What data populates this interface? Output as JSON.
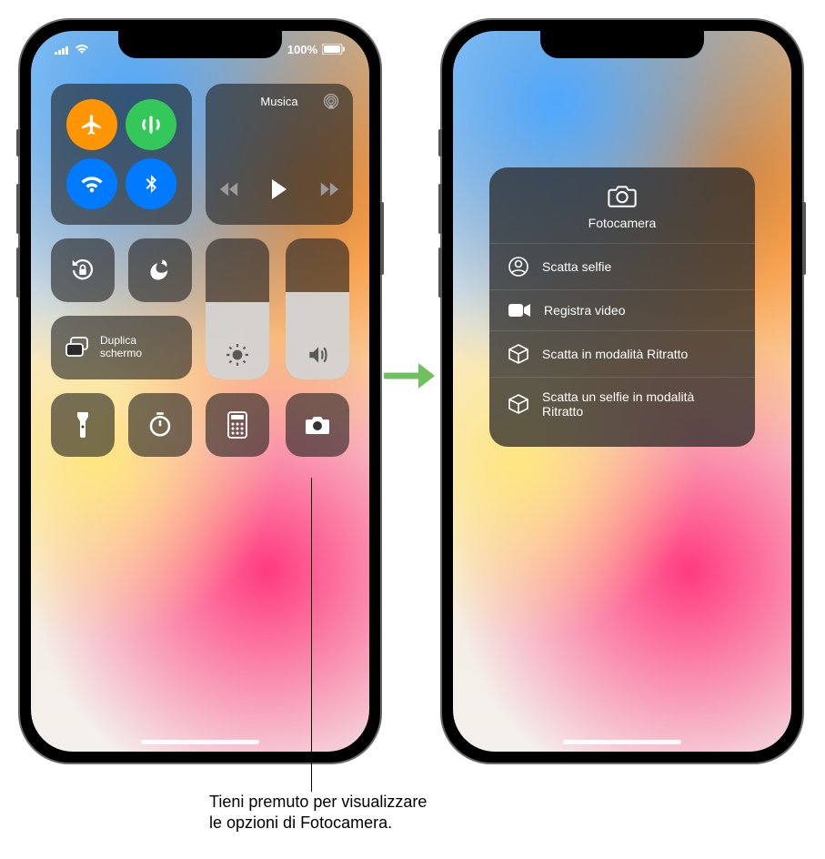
{
  "status": {
    "battery": "100%"
  },
  "music": {
    "title": "Musica"
  },
  "mirror": {
    "line1": "Duplica",
    "line2": "schermo"
  },
  "camera_panel": {
    "title": "Fotocamera",
    "opt0": "Scatta selfie",
    "opt1": "Registra video",
    "opt2": "Scatta in modalità Ritratto",
    "opt3": "Scatta un selfie in modalità Ritratto"
  },
  "caption": {
    "line1": "Tieni premuto per visualizzare",
    "line2": "le opzioni di Fotocamera."
  }
}
